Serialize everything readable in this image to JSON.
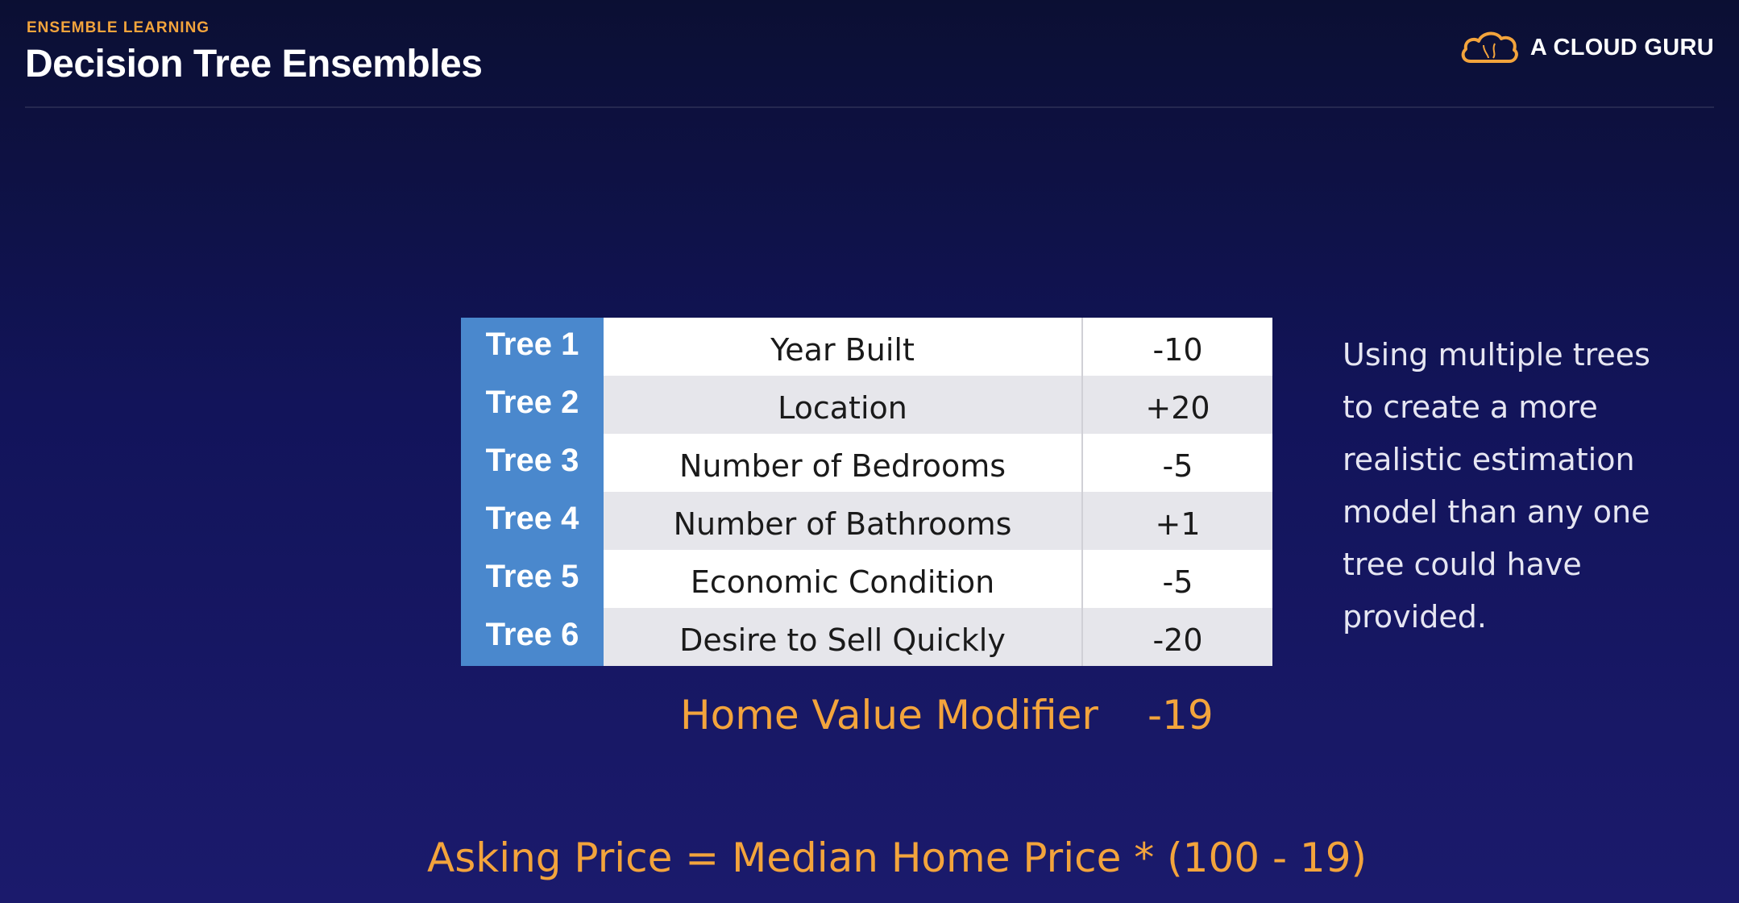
{
  "header": {
    "kicker": "ENSEMBLE LEARNING",
    "title": "Decision Tree Ensembles",
    "brand": "A CLOUD GURU",
    "brand_icon": "cloud-icon"
  },
  "table": {
    "rows": [
      {
        "tree": "Tree 1",
        "factor": "Year Built",
        "value": "-10"
      },
      {
        "tree": "Tree 2",
        "factor": "Location",
        "value": "+20"
      },
      {
        "tree": "Tree 3",
        "factor": "Number of Bedrooms",
        "value": "-5"
      },
      {
        "tree": "Tree 4",
        "factor": "Number of Bathrooms",
        "value": "+1"
      },
      {
        "tree": "Tree 5",
        "factor": "Economic Condition",
        "value": "-5"
      },
      {
        "tree": "Tree 6",
        "factor": "Desire to Sell Quickly",
        "value": "-20"
      }
    ]
  },
  "side_text": {
    "lines": [
      "Using multiple trees",
      "to create a more",
      "realistic estimation",
      "model than any one",
      "tree could have",
      "provided."
    ]
  },
  "summary": {
    "label": "Home Value Modifier",
    "value": "-19",
    "formula": "Asking Price = Median Home Price * (100 - 19)"
  },
  "colors": {
    "accent": "#f3a43c",
    "tree_label_bg": "#4a88cd",
    "background": "#12145a"
  }
}
